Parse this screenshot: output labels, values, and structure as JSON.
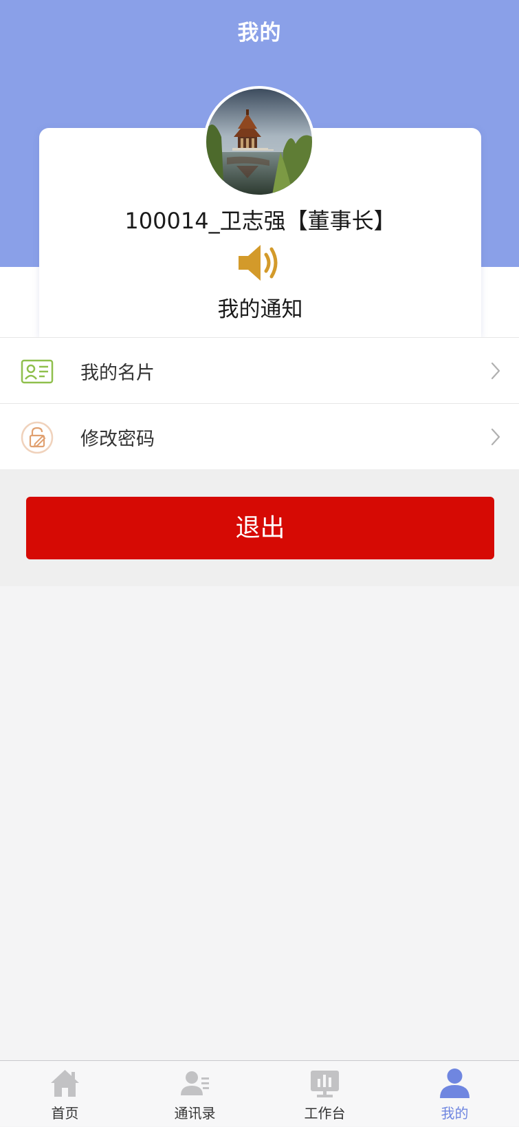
{
  "header": {
    "title": "我的"
  },
  "profile": {
    "name": "100014_卫志强【董事长】",
    "notification_label": "我的通知",
    "avatar_icon": "pavilion-photo"
  },
  "menu": {
    "items": [
      {
        "label": "我的名片",
        "icon": "id-card-icon",
        "icon_color": "#8fbf4c"
      },
      {
        "label": "修改密码",
        "icon": "lock-edit-icon",
        "icon_color": "#e0a070"
      }
    ]
  },
  "logout": {
    "label": "退出",
    "color": "#d60a04"
  },
  "tabbar": {
    "items": [
      {
        "label": "首页",
        "icon": "home-icon"
      },
      {
        "label": "通讯录",
        "icon": "contacts-icon"
      },
      {
        "label": "工作台",
        "icon": "workbench-icon"
      },
      {
        "label": "我的",
        "icon": "person-icon"
      }
    ],
    "active_color": "#6f86e0",
    "inactive_color": "#c2c2c4"
  },
  "colors": {
    "header_bg": "#8aa0e8",
    "accent_speaker": "#d39a2a"
  }
}
